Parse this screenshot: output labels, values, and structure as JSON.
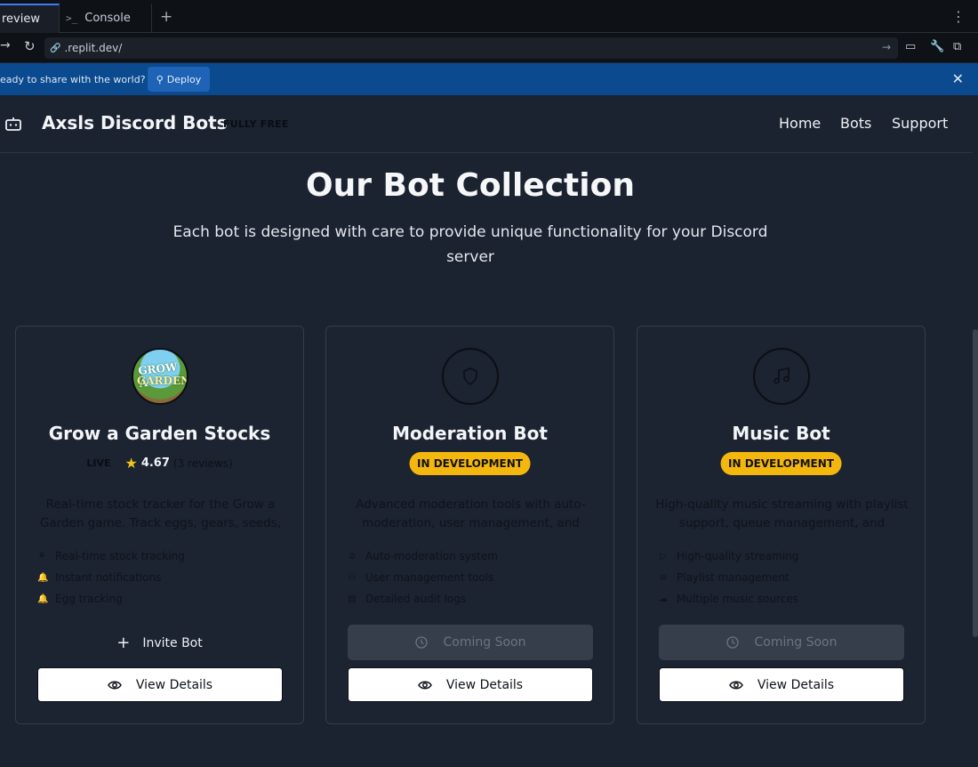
{
  "browser": {
    "tabs": [
      {
        "label": "review"
      },
      {
        "label": "Console"
      }
    ],
    "url": ".replit.dev/"
  },
  "deploy_banner": {
    "text": "eady to share with the world?",
    "button_label": "Deploy"
  },
  "header": {
    "brand": "Axsls Discord Bots",
    "badge": "FULLY FREE",
    "nav": [
      "Home",
      "Bots",
      "Support"
    ]
  },
  "hero": {
    "title": "Our Bot Collection",
    "subtitle": "Each bot is designed with care to provide unique functionality for your Discord server"
  },
  "bots": [
    {
      "name": "Grow a Garden Stocks",
      "avatar_text": [
        "GROW A",
        "GARDEN"
      ],
      "status": "LIVE",
      "rating": "4.67",
      "reviews": "(3 reviews)",
      "description": "Real-time stock tracker for the Grow a Garden game. Track eggs, gears, seeds,",
      "features": [
        {
          "icon": "sprout-icon",
          "label": "Real-time stock tracking"
        },
        {
          "icon": "bell-icon",
          "label": "Instant notifications"
        },
        {
          "icon": "bell-icon",
          "label": "Egg tracking"
        }
      ],
      "primary_action": "Invite Bot",
      "details_label": "View Details"
    },
    {
      "name": "Moderation Bot",
      "icon": "shield-icon",
      "status": "IN DEVELOPMENT",
      "description": "Advanced moderation tools with auto-moderation, user management, and",
      "features": [
        {
          "icon": "ban-icon",
          "label": "Auto-moderation system"
        },
        {
          "icon": "users-icon",
          "label": "User management tools"
        },
        {
          "icon": "clipboard-icon",
          "label": "Detailed audit logs"
        }
      ],
      "primary_action": "Coming Soon",
      "details_label": "View Details"
    },
    {
      "name": "Music Bot",
      "icon": "music-icon",
      "status": "IN DEVELOPMENT",
      "description": "High-quality music streaming with playlist support, queue management, and",
      "features": [
        {
          "icon": "play-icon",
          "label": "High-quality streaming"
        },
        {
          "icon": "list-icon",
          "label": "Playlist management"
        },
        {
          "icon": "cloud-icon",
          "label": "Multiple music sources"
        }
      ],
      "primary_action": "Coming Soon",
      "details_label": "View Details"
    }
  ],
  "colors": {
    "background": "#1b2230",
    "badge_dev": "#f3b70e",
    "star": "#f2c317",
    "deploy_bar": "#0b4a8f"
  }
}
